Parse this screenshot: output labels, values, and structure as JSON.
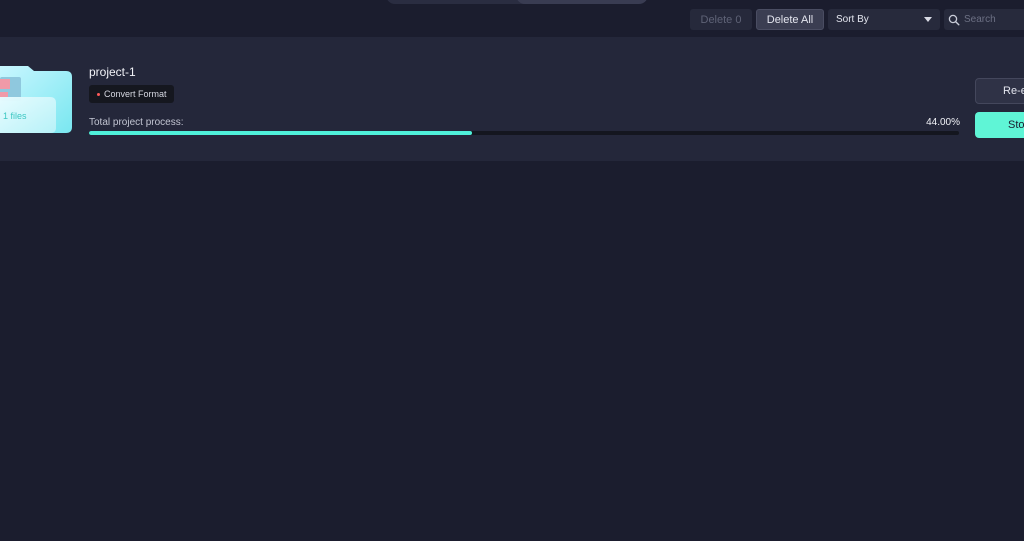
{
  "toolbar": {
    "delete_label": "Delete 0",
    "delete_all_label": "Delete All",
    "sort_label": "Sort By",
    "search_placeholder": "Search"
  },
  "project": {
    "name": "project-1",
    "file_count_label": "1 files",
    "tag_label": "Convert Format",
    "progress_label": "Total project process:",
    "progress_value_text": "44.00%",
    "progress_fraction": 0.44,
    "reexport_label": "Re-e",
    "stop_label": "Sto"
  },
  "colors": {
    "background": "#1b1d2e",
    "card": "#24273a",
    "accent": "#4ff0da",
    "tag_dot": "#ff5a5a"
  },
  "icons": {
    "folder": "folder-icon",
    "search": "search-icon",
    "dropdown": "chevron-down-icon"
  }
}
